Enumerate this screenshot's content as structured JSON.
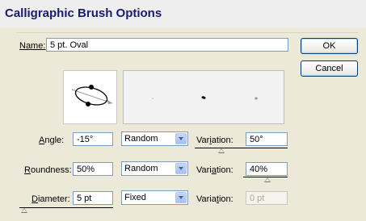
{
  "window": {
    "title": "Calligraphic Brush Options"
  },
  "name_field": {
    "label": "Name:",
    "value": "5 pt. Oval"
  },
  "buttons": {
    "ok": "OK",
    "cancel": "Cancel"
  },
  "rows": {
    "angle": {
      "label": "Angle:",
      "value": "-15°",
      "mode": "Random",
      "variation_label": "Variation:",
      "variation": "50°",
      "variation_disabled": false
    },
    "roundness": {
      "label": "Roundness:",
      "value": "50%",
      "mode": "Random",
      "variation_label": "Variation:",
      "variation": "40%",
      "variation_disabled": false
    },
    "diameter": {
      "label": "Diameter:",
      "value": "5 pt",
      "mode": "Fixed",
      "variation_label": "Variation:",
      "variation": "0 pt",
      "variation_disabled": true
    }
  },
  "colors": {
    "title": "#1a1a6e",
    "field_border": "#7f9db9",
    "dialog_bg": "#ece9d8"
  }
}
